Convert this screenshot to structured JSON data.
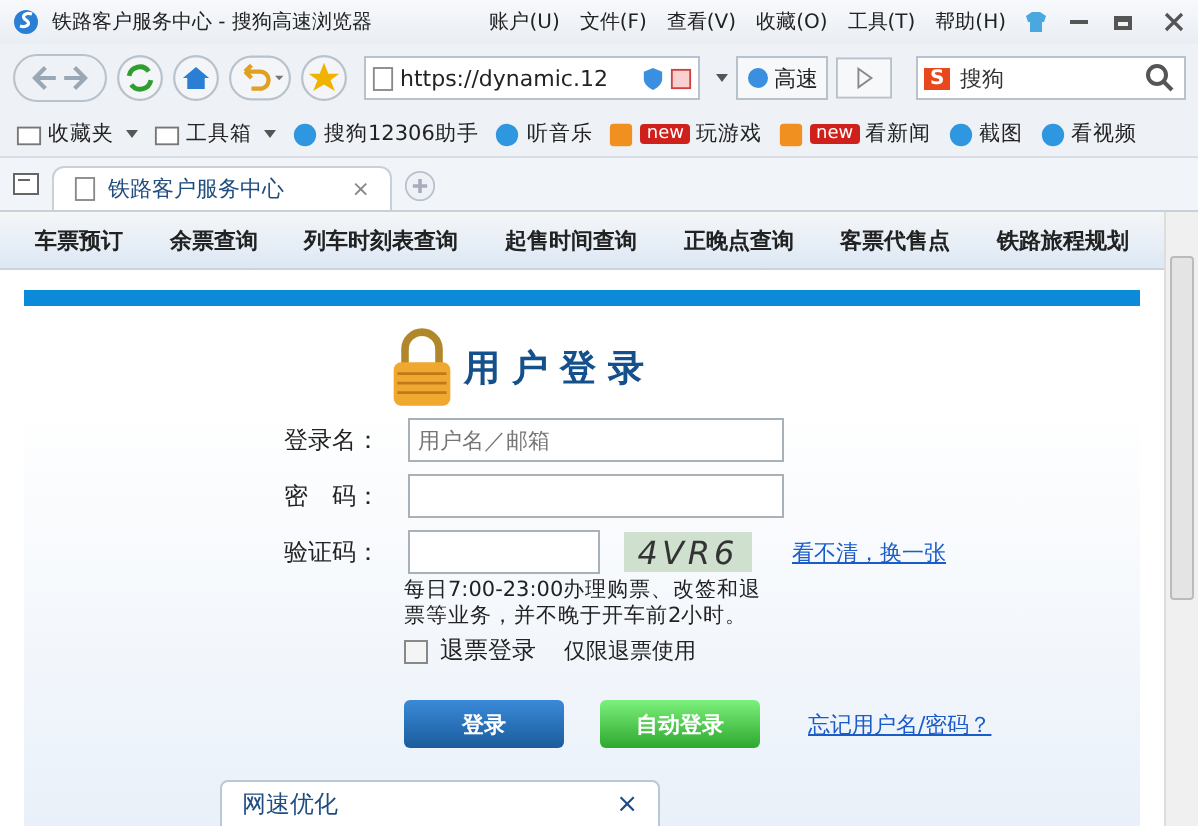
{
  "window": {
    "title": "铁路客户服务中心 - 搜狗高速浏览器"
  },
  "menu": [
    "账户(U)",
    "文件(F)",
    "查看(V)",
    "收藏(O)",
    "工具(T)",
    "帮助(H)"
  ],
  "address_bar": {
    "url": "https://dynamic.12",
    "speed_label": "高速"
  },
  "search": {
    "engine_logo": "S",
    "placeholder": "搜狗"
  },
  "bookmarks": [
    {
      "label": "收藏夹",
      "kind": "folder"
    },
    {
      "label": "工具箱",
      "kind": "folder"
    },
    {
      "label": "搜狗12306助手",
      "kind": "link"
    },
    {
      "label": "听音乐",
      "kind": "link"
    },
    {
      "label": "玩游戏",
      "kind": "new",
      "badge": "new"
    },
    {
      "label": "看新闻",
      "kind": "new",
      "badge": "new"
    },
    {
      "label": "截图",
      "kind": "link"
    },
    {
      "label": "看视频",
      "kind": "link"
    }
  ],
  "tabs": [
    {
      "label": "铁路客户服务中心",
      "selected": true,
      "close": "×"
    }
  ],
  "nav": [
    "车票预订",
    "余票查询",
    "列车时刻表查询",
    "起售时间查询",
    "正晚点查询",
    "客票代售点",
    "铁路旅程规划"
  ],
  "login": {
    "title": "用户登录",
    "fields": [
      {
        "label": "登录名：",
        "placeholder": "用户名／邮箱",
        "kind": "text"
      },
      {
        "label": "密　码：",
        "kind": "text"
      },
      {
        "label": "验证码：",
        "kind": "captcha",
        "captcha": "4VR6",
        "refresh_link": "看不清，换一张"
      }
    ],
    "notice": "每日7:00-23:00办理购票、改签和退票等业务，并不晚于开车前2小时。",
    "refund_login": {
      "label": "退票登录",
      "checked": false,
      "note": "仅限退票使用"
    },
    "buttons": [
      {
        "label": "登录",
        "kind": "primary"
      },
      {
        "label": "自动登录",
        "kind": "auto"
      }
    ],
    "forgot_link": "忘记用户名/密码？"
  },
  "popup": {
    "title": "网速优化",
    "close": "×"
  }
}
